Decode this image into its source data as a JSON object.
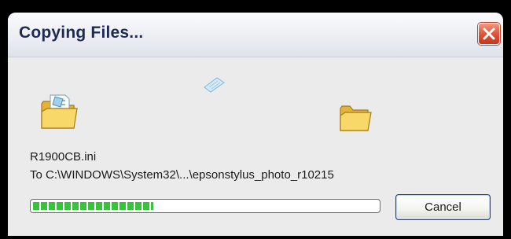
{
  "window": {
    "title": "Copying Files..."
  },
  "icons": {
    "close": "close-icon",
    "source_folder": "folder-with-document-icon",
    "destination_folder": "folder-icon",
    "in_transit_document": "flying-document-icon"
  },
  "content": {
    "file_name": "R1900CB.ini",
    "destination": "To C:\\WINDOWS\\System32\\...\\epsonstylus_photo_r10215"
  },
  "progress": {
    "fraction": 0.35
  },
  "buttons": {
    "cancel_label": "Cancel"
  },
  "colors": {
    "progress": "#37c43b",
    "close_button": "#d9472e",
    "title_text": "#1d2a52"
  }
}
